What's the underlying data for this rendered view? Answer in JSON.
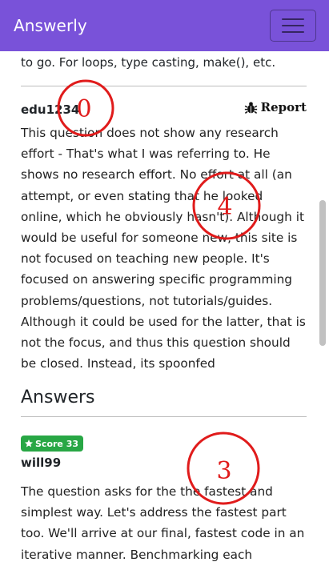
{
  "app": {
    "brand": "Answerly"
  },
  "question": {
    "tail_text": "to go. For loops, type casting, make(), etc."
  },
  "comment": {
    "author": "edu1234",
    "report_label": "Report",
    "body": "This question does not show any research effort - That's what I was referring to. He shows no research effort. No effort at all (an attempt, or even stating that he looked online, which he obviously hasn't). Although it would be useful for someone new, this site is not focused on teaching new people. It's focused on answering specific programming problems/questions, not tutorials/guides. Although it could be used for the latter, that is not the focus, and thus this question should be closed. Instead, its spoonfed"
  },
  "answers": {
    "heading": "Answers",
    "items": [
      {
        "score_label": "Score 33",
        "author": "will99",
        "body": "The question asks for the the fastest and simplest way. Let's address the fastest part too. We'll arrive at our final, fastest code in an iterative manner. Benchmarking each iteration"
      }
    ]
  },
  "annotations": [
    {
      "label": "0",
      "color": "#e01b1b"
    },
    {
      "label": "4",
      "color": "#e01b1b"
    },
    {
      "label": "3",
      "color": "#e01b1b"
    }
  ],
  "colors": {
    "navbar": "#7952d9",
    "badge": "#28a745",
    "annotation": "#e01b1b"
  },
  "icons": {
    "menu": "hamburger-icon",
    "report": "bug-icon",
    "score": "star-icon"
  }
}
